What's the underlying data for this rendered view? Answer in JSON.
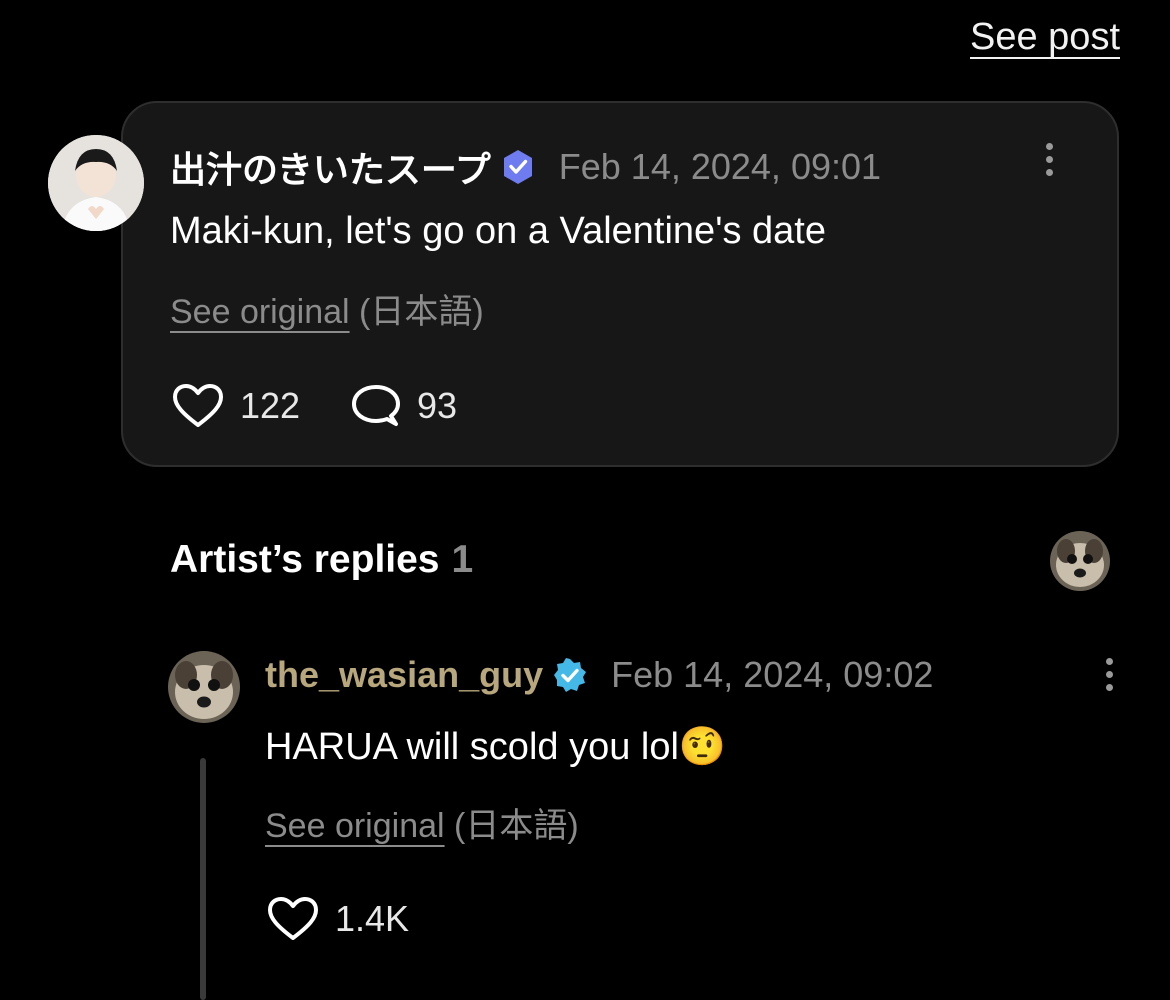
{
  "header": {
    "see_post_label": "See post"
  },
  "post": {
    "author": "出汁のきいたスープ",
    "verified_icon": "purple-verified-badge-icon",
    "timestamp": "Feb 14, 2024, 09:01",
    "text": "Maki-kun, let's go on a Valentine's date",
    "see_original_label": "See original",
    "original_language": "(日本語)",
    "likes": "122",
    "comments": "93"
  },
  "artist_replies": {
    "title": "Artist’s replies",
    "count": "1"
  },
  "reply": {
    "author": "the_wasian_guy",
    "verified_icon": "blue-verified-badge-icon",
    "timestamp": "Feb 14, 2024, 09:02",
    "text": "HARUA will scold you lol",
    "emoji": "🤨",
    "see_original_label": "See original",
    "original_language": "(日本語)",
    "likes": "1.4K"
  },
  "colors": {
    "background": "#000000",
    "card": "#171717",
    "muted_text": "#8b8b8b",
    "reply_author": "#b8a77c",
    "post_badge": "#6f7cf0",
    "reply_badge": "#44b8e6"
  }
}
